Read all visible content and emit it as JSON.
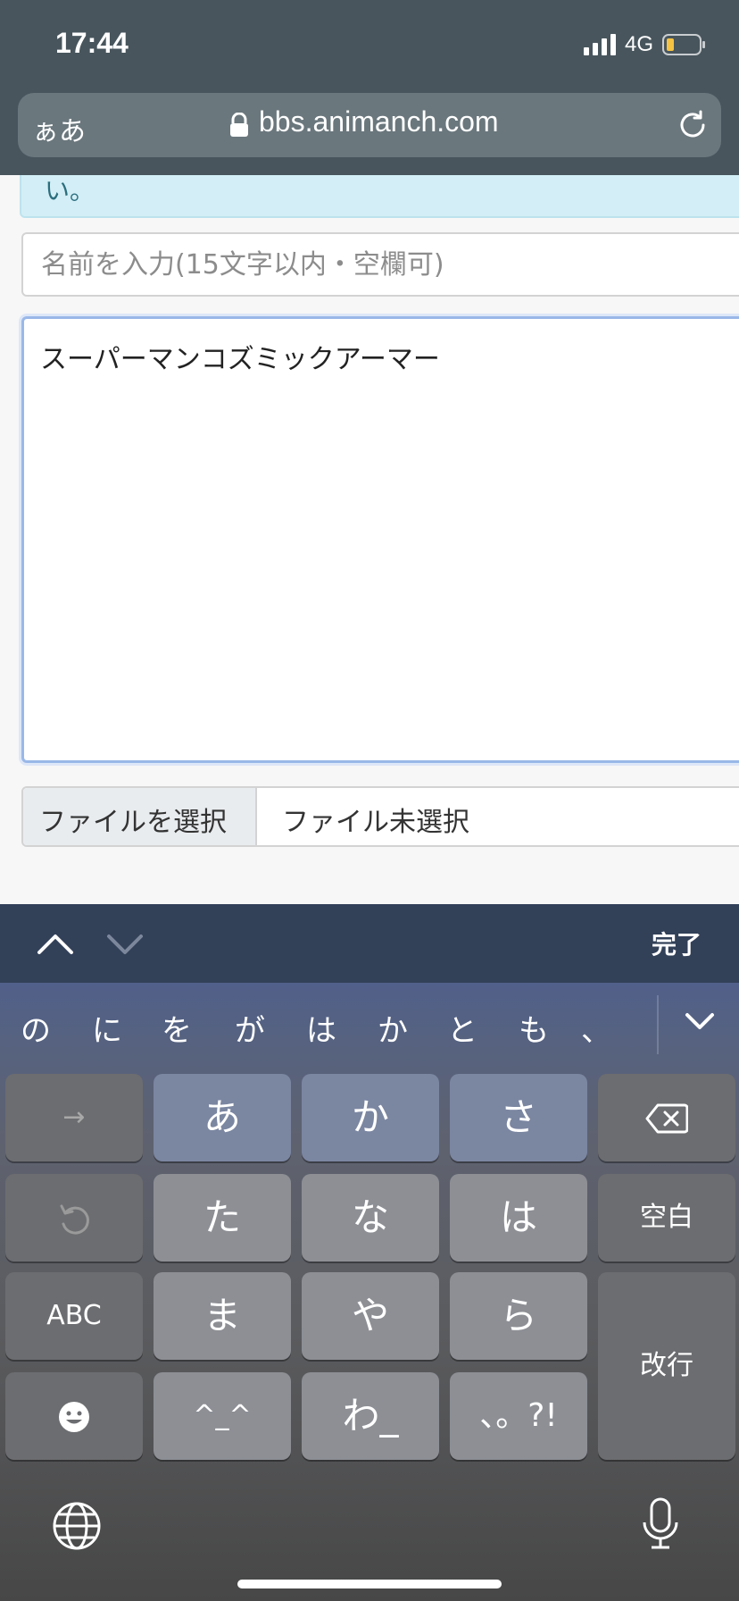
{
  "status_bar": {
    "time": "17:44",
    "network": "4G",
    "battery_level": 0.2,
    "battery_color": "#f5c242"
  },
  "browser": {
    "aa_label": "ぁあ",
    "url": "bbs.animanch.com",
    "lock_icon": "lock-icon",
    "reload_icon": "reload-icon"
  },
  "form": {
    "notice_text": "い。",
    "name_placeholder": "名前を入力(15文字以内・空欄可)",
    "body_text": "スーパーマンコズミックアーマー",
    "file_button_label": "ファイルを選択",
    "file_status": "ファイル未選択"
  },
  "accessory": {
    "done_label": "完了"
  },
  "keyboard": {
    "suggestions": [
      "の",
      "に",
      "を",
      "が",
      "は",
      "か",
      "と",
      "も",
      "、"
    ],
    "rows": [
      [
        "→",
        "あ",
        "か",
        "さ",
        "⌫"
      ],
      [
        "↺",
        "た",
        "な",
        "は",
        "空白"
      ],
      [
        "ABC",
        "ま",
        "や",
        "ら",
        "改行"
      ],
      [
        "☺",
        "^_^",
        "わ_",
        "、。?!"
      ]
    ],
    "keys": {
      "next": "→",
      "a": "あ",
      "ka": "か",
      "sa": "さ",
      "undo": "↺",
      "ta": "た",
      "na": "な",
      "ha": "は",
      "space": "空白",
      "abc": "ABC",
      "ma": "ま",
      "ya": "や",
      "ra": "ら",
      "return": "改行",
      "kaomoji": "^_^",
      "wa": "わ_",
      "punct": "、。?!"
    }
  }
}
